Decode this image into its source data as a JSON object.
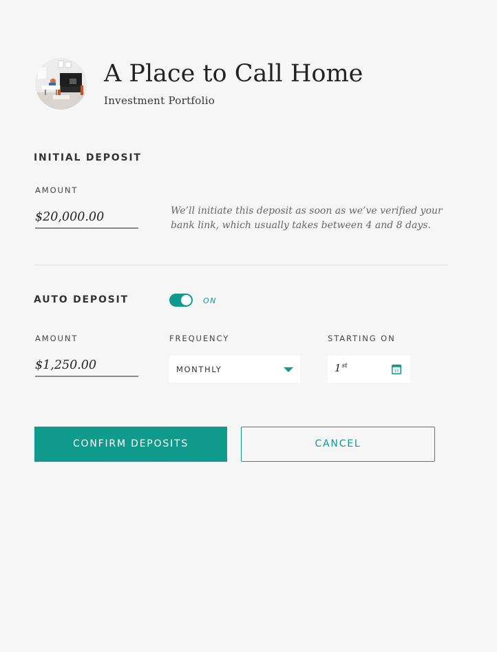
{
  "header": {
    "title": "A Place to Call Home",
    "subtitle": "Investment Portfolio",
    "avatar_icon": "living-room-photo"
  },
  "initial_deposit": {
    "heading": "INITIAL DEPOSIT",
    "amount_label": "AMOUNT",
    "amount_value": "$20,000.00",
    "note": "We’ll initiate this deposit as soon as we’ve verified your bank link, which usually takes between 4 and 8 days."
  },
  "auto_deposit": {
    "heading": "AUTO DEPOSIT",
    "toggle_state": "ON",
    "toggle_on": true,
    "amount_label": "AMOUNT",
    "amount_value": "$1,250.00",
    "frequency_label": "FREQUENCY",
    "frequency_value": "MONTHLY",
    "starting_label": "STARTING ON",
    "starting_day": "1",
    "starting_suffix": "st",
    "calendar_icon": "calendar-icon",
    "calendar_day": "15"
  },
  "actions": {
    "confirm_label": "CONFIRM DEPOSITS",
    "cancel_label": "CANCEL"
  },
  "colors": {
    "accent": "#0f9a8b",
    "background": "#f6f6f6"
  }
}
